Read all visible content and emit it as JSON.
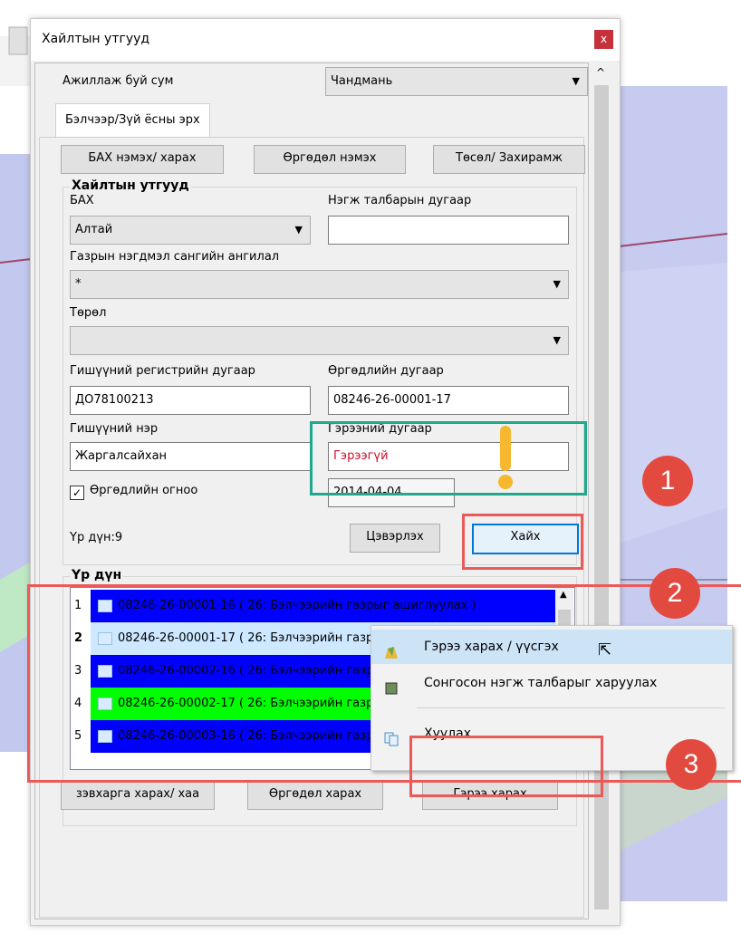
{
  "dialog": {
    "title": "Хайлтын утгууд",
    "close_label": "x"
  },
  "top": {
    "sum_label": "Ажиллаж буй сум",
    "sum_value": "Чандмань",
    "tab_label": "Бэлчээр/Зүй ёсны эрх"
  },
  "actions": {
    "bah_button": "БАХ нэмэх/ харах",
    "request_add_button": "Өргөдөл нэмэх",
    "project_button": "Төсөл/ Захирамж"
  },
  "search": {
    "group_title": "Хайлтын утгууд",
    "bah_label": "БАХ",
    "bah_value": "Алтай",
    "unit_label": "Нэгж талбарын дугаар",
    "unit_value": "",
    "category_label": "Газрын нэгдмэл сангийн ангилал",
    "category_value": "*",
    "type_label": "Төрөл",
    "type_value": "",
    "reg_label": "Гишүүний регистрийн дугаар",
    "reg_value": "ДО78100213",
    "req_no_label": "Өргөдлийн дугаар",
    "req_no_value": "08246-26-00001-17",
    "member_name_label": "Гишүүний нэр",
    "member_name_value": "Жаргалсайхан",
    "contract_no_label": "Гэрээний дугаар",
    "contract_no_value": "Гэрээгүй",
    "date_checkbox_label": "Өргөдлийн огноо",
    "date_value": "2014-04-04",
    "result_count": "Үр дүн:9",
    "clear_button": "Цэвэрлэх",
    "search_button": "Хайх"
  },
  "results": {
    "group_title": "Үр дүн",
    "rows": [
      {
        "num": "1",
        "text": "08246-26-00001-16 ( 26: Бэлчээрийн газрыг ашиглуулах )"
      },
      {
        "num": "2",
        "text": "08246-26-00001-17 ( 26: Бэлчээрийн газрыг ашиглуулах )"
      },
      {
        "num": "3",
        "text": "08246-26-00002-16 ( 26: Бэлчээрийн газрыг ашиглуулах )"
      },
      {
        "num": "4",
        "text": "08246-26-00002-17 ( 26: Бэлчээрийн газрыг ашиглуулах )"
      },
      {
        "num": "5",
        "text": "08246-26-00003-16 ( 26: Бэлчээрийн газрыг ашиглуулах )"
      }
    ],
    "row_colors": [
      "#0000ff",
      "#cde8ff",
      "#0000ff",
      "#00ff00",
      "#0000ff"
    ],
    "row_text_colors": [
      "#000000",
      "#000000",
      "#000000",
      "#000000",
      "#000000"
    ]
  },
  "bottom": {
    "map_button": "зэвхарга харах/ хаа",
    "view_request_button": "Өргөдөл харах",
    "view_contract_button": "Гэрээ харах"
  },
  "context_menu": {
    "items": [
      {
        "label": "Гэрээ харах / үүсгэх",
        "icon": "contract-icon"
      },
      {
        "label": "Сонгосон нэгж талбарыг харуулах",
        "icon": "parcel-icon"
      },
      {
        "label": "Хуулах",
        "icon": "copy-icon"
      }
    ]
  },
  "annotations": {
    "step1": "1",
    "step2": "2",
    "step3": "3",
    "exclamation": "!"
  },
  "colors": {
    "annotation_red": "#e24a40",
    "highlight_teal": "#1ea88c",
    "selection_blue": "#0000ff",
    "selection_green": "#00ff00"
  }
}
